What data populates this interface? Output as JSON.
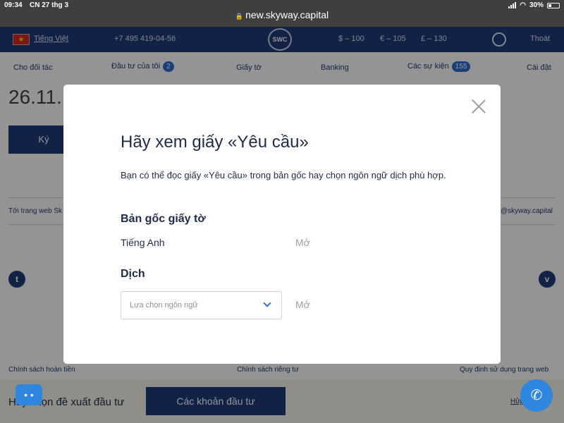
{
  "status": {
    "time": "09:34",
    "date": "CN 27 thg 3",
    "battery": "30%"
  },
  "browser": {
    "url": "new.skyway.capital"
  },
  "header": {
    "language": "Tiếng Việt",
    "phone": "+7 495 419-04-56",
    "logo_text": "SWC",
    "currency_usd": "$ – 100",
    "currency_eur": "€ – 105",
    "currency_gbp": "£ – 130",
    "logout": "Thoát"
  },
  "nav": {
    "partners": "Cho đối tác",
    "investments": "Đầu tư của tôi",
    "investments_badge": "2",
    "documents": "Giấy tờ",
    "banking": "Banking",
    "events": "Các sự kiện",
    "events_badge": "155",
    "settings": "Cài đặt"
  },
  "background": {
    "date_partial": "26.11.",
    "sign_button": "Ký",
    "site_link": "Tới trang web Sk",
    "email_partial": "@skyway.capital",
    "footer_refund": "Chính sách hoàn tiền",
    "footer_privacy": "Chính sách riêng tư",
    "footer_terms": "Quy định sử dụng trang web",
    "bottom_text": "Hãy chọn đề xuất đầu tư",
    "bottom_button": "Các khoản đầu tư",
    "bottom_cancel": "Hủy"
  },
  "modal": {
    "title": "Hãy xem giấy «Yêu cầu»",
    "description": "Bạn có thể đọc giấy «Yêu cầu» trong bản gốc hay chọn ngôn ngữ dịch phù hợp.",
    "original_heading": "Bản gốc giấy tờ",
    "original_language": "Tiếng Anh",
    "original_open": "Mở",
    "translate_heading": "Dịch",
    "select_placeholder": "Lựa chọn ngôn ngữ",
    "translate_open": "Mở"
  }
}
